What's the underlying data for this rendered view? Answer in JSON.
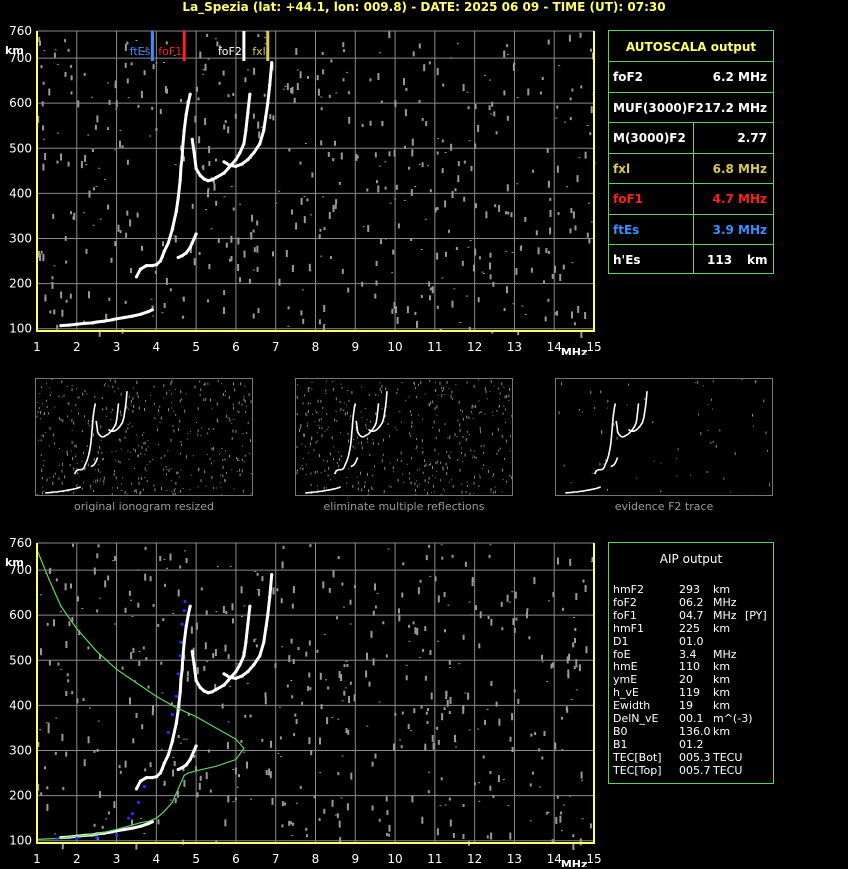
{
  "title": "La_Spezia (lat: +44.1, lon: 009.8) - DATE: 2025 06 09 - TIME (UT): 07:30",
  "colors": {
    "yellow": "#ffff66",
    "green": "#5fd35f",
    "red": "#ff2020",
    "blue": "#3a8fff",
    "olive": "#d9c85a",
    "grid": "#8a8a8a"
  },
  "autoscala": {
    "title": "AUTOSCALA output",
    "rows": [
      {
        "label": "foF2",
        "value": "6.2 MHz",
        "color": "#ffffff"
      },
      {
        "label": "MUF(3000)F2",
        "value": "17.2 MHz",
        "color": "#ffffff"
      },
      {
        "label": "M(3000)F2",
        "value": "2.77",
        "color": "#ffffff"
      },
      {
        "label": "fxl",
        "value": "6.8 MHz",
        "color": "#d9c85a"
      },
      {
        "label": "foF1",
        "value": "4.7 MHz",
        "color": "#ff2020"
      },
      {
        "label": "ftEs",
        "value": "3.9 MHz",
        "color": "#3a8fff"
      },
      {
        "label": "h'Es",
        "value": "113",
        "unit": "km",
        "color": "#ffffff"
      }
    ]
  },
  "aip": {
    "title": "AIP output",
    "rows": [
      {
        "name": "hmF2",
        "value": "293",
        "unit": "km",
        "flag": ""
      },
      {
        "name": "foF2",
        "value": "06.2",
        "unit": "MHz",
        "flag": ""
      },
      {
        "name": "foF1",
        "value": "04.7",
        "unit": "MHz",
        "flag": "[PY]"
      },
      {
        "name": "hmF1",
        "value": "225",
        "unit": "km",
        "flag": ""
      },
      {
        "name": "D1",
        "value": "01.0",
        "unit": "",
        "flag": ""
      },
      {
        "name": "foE",
        "value": "3.4",
        "unit": "MHz",
        "flag": ""
      },
      {
        "name": "hmE",
        "value": "110",
        "unit": "km",
        "flag": ""
      },
      {
        "name": "ymE",
        "value": "20",
        "unit": "km",
        "flag": ""
      },
      {
        "name": "h_vE",
        "value": "119",
        "unit": "km",
        "flag": ""
      },
      {
        "name": "Ewidth",
        "value": "19",
        "unit": "km",
        "flag": ""
      },
      {
        "name": "DelN_vE",
        "value": "00.1",
        "unit": "m^(-3)",
        "flag": ""
      },
      {
        "name": "B0",
        "value": "136.0",
        "unit": "km",
        "flag": ""
      },
      {
        "name": "B1",
        "value": "01.2",
        "unit": "",
        "flag": ""
      },
      {
        "name": "TEC[Bot]",
        "value": "005.3",
        "unit": "TECU",
        "flag": ""
      },
      {
        "name": "TEC[Top]",
        "value": "005.7",
        "unit": "TECU",
        "flag": ""
      }
    ]
  },
  "thumbnails": [
    {
      "label": "original ionogram resized"
    },
    {
      "label": "eliminate multiple reflections"
    },
    {
      "label": "evidence F2 trace"
    }
  ],
  "chart_data": [
    {
      "type": "scatter",
      "title": "",
      "xlabel": "MHz",
      "ylabel": "km",
      "xlim": [
        1,
        15
      ],
      "ylim": [
        95,
        760
      ],
      "xticks": [
        "1",
        "2",
        "3",
        "4",
        "5",
        "6",
        "7",
        "8",
        "9",
        "10",
        "11",
        "12",
        "13",
        "14",
        "15"
      ],
      "yticks": [
        "100",
        "200",
        "300",
        "400",
        "500",
        "600",
        "700",
        "760"
      ],
      "grid": true,
      "markers": [
        {
          "name": "ftEs",
          "x": 3.9,
          "color": "#3a8fff"
        },
        {
          "name": "foF1",
          "x": 4.7,
          "color": "#ff2020"
        },
        {
          "name": "foF2",
          "x": 6.2,
          "color": "#ffffff"
        },
        {
          "name": "fxl",
          "x": 6.8,
          "color": "#d9c85a"
        }
      ],
      "series": [
        {
          "name": "",
          "color": "#ffffff",
          "kind": "trace",
          "x": [
            3.5,
            3.6,
            3.75,
            3.9,
            4.0,
            4.1,
            4.15,
            4.2,
            4.3,
            4.4,
            4.5,
            4.55,
            4.6,
            4.62,
            4.65,
            4.66,
            4.7,
            4.75,
            4.8,
            4.85
          ],
          "y": [
            215,
            232,
            240,
            240,
            242,
            250,
            260,
            272,
            290,
            320,
            360,
            390,
            430,
            460,
            480,
            500,
            540,
            575,
            600,
            620
          ]
        },
        {
          "name": "",
          "color": "#ffffff",
          "kind": "trace",
          "x": [
            4.55,
            4.65,
            4.75,
            4.85,
            4.9,
            4.95,
            5.0
          ],
          "y": [
            258,
            262,
            268,
            280,
            290,
            300,
            310
          ]
        },
        {
          "name": "",
          "color": "#ffffff",
          "kind": "trace",
          "x": [
            4.9,
            4.95,
            5.0,
            5.1,
            5.2,
            5.3,
            5.4,
            5.5,
            5.7,
            5.8,
            5.9,
            6.0,
            6.1,
            6.2,
            6.25,
            6.3,
            6.35
          ],
          "y": [
            520,
            490,
            455,
            440,
            432,
            428,
            430,
            435,
            445,
            455,
            465,
            475,
            490,
            510,
            540,
            580,
            620
          ]
        },
        {
          "name": "",
          "color": "#ffffff",
          "kind": "trace",
          "x": [
            5.7,
            5.85,
            6.0,
            6.15,
            6.3,
            6.45,
            6.6,
            6.7,
            6.75,
            6.8,
            6.85,
            6.9
          ],
          "y": [
            470,
            462,
            460,
            465,
            475,
            490,
            510,
            540,
            570,
            600,
            640,
            690
          ]
        },
        {
          "name": "",
          "color": "#ffffff",
          "kind": "trace",
          "x": [
            1.6,
            1.8,
            2.0,
            2.2,
            2.4,
            2.5,
            2.7,
            2.9,
            3.0,
            3.2,
            3.4,
            3.6,
            3.8,
            3.9
          ],
          "y": [
            107,
            108,
            110,
            112,
            113,
            115,
            117,
            120,
            122,
            125,
            128,
            132,
            138,
            142
          ]
        }
      ]
    },
    {
      "type": "scatter",
      "title": "",
      "xlabel": "MHz",
      "ylabel": "km",
      "xlim": [
        1,
        15
      ],
      "ylim": [
        95,
        760
      ],
      "xticks": [
        "1",
        "2",
        "3",
        "4",
        "5",
        "6",
        "7",
        "8",
        "9",
        "10",
        "11",
        "12",
        "13",
        "14",
        "15"
      ],
      "yticks": [
        "100",
        "200",
        "300",
        "400",
        "500",
        "600",
        "700",
        "760"
      ],
      "grid": true,
      "series": [
        {
          "name": "",
          "color": "#ffffff",
          "kind": "trace",
          "x": [
            3.5,
            3.6,
            3.75,
            3.9,
            4.0,
            4.1,
            4.15,
            4.2,
            4.3,
            4.4,
            4.5,
            4.55,
            4.6,
            4.62,
            4.65,
            4.66,
            4.7,
            4.75,
            4.8,
            4.85
          ],
          "y": [
            215,
            232,
            240,
            240,
            242,
            250,
            260,
            272,
            290,
            320,
            360,
            390,
            430,
            460,
            480,
            500,
            540,
            575,
            600,
            620
          ]
        },
        {
          "name": "",
          "color": "#ffffff",
          "kind": "trace",
          "x": [
            4.55,
            4.65,
            4.75,
            4.85,
            4.9,
            4.95,
            5.0
          ],
          "y": [
            258,
            262,
            268,
            280,
            290,
            300,
            310
          ]
        },
        {
          "name": "",
          "color": "#ffffff",
          "kind": "trace",
          "x": [
            4.9,
            4.95,
            5.0,
            5.1,
            5.2,
            5.3,
            5.4,
            5.5,
            5.7,
            5.8,
            5.9,
            6.0,
            6.1,
            6.2,
            6.25,
            6.3,
            6.35
          ],
          "y": [
            520,
            490,
            455,
            440,
            432,
            428,
            430,
            435,
            445,
            455,
            465,
            475,
            490,
            510,
            540,
            580,
            620
          ]
        },
        {
          "name": "",
          "color": "#ffffff",
          "kind": "trace",
          "x": [
            5.7,
            5.85,
            6.0,
            6.15,
            6.3,
            6.45,
            6.6,
            6.7,
            6.75,
            6.8,
            6.85,
            6.9
          ],
          "y": [
            470,
            462,
            460,
            465,
            475,
            490,
            510,
            540,
            570,
            600,
            640,
            690
          ]
        },
        {
          "name": "",
          "color": "#ffffff",
          "kind": "trace",
          "x": [
            1.6,
            1.8,
            2.0,
            2.2,
            2.4,
            2.5,
            2.7,
            2.9,
            3.0,
            3.2,
            3.4,
            3.6,
            3.8,
            3.9
          ],
          "y": [
            107,
            108,
            110,
            112,
            113,
            115,
            117,
            120,
            122,
            125,
            128,
            132,
            138,
            142
          ]
        },
        {
          "name": "",
          "color": "#5fd35f",
          "kind": "profile",
          "x": [
            1.0,
            1.3,
            1.6,
            2.0,
            2.5,
            3.0,
            3.5,
            4.0,
            4.5,
            5.0,
            5.5,
            6.0,
            6.2,
            6.0,
            5.5,
            5.0,
            4.8,
            4.7,
            4.6,
            4.5,
            4.4,
            4.2,
            4.0,
            3.8,
            3.6,
            3.4,
            3.2,
            3.0,
            2.5,
            2.0,
            1.5,
            1.0
          ],
          "y": [
            745,
            680,
            620,
            570,
            520,
            480,
            450,
            420,
            395,
            375,
            350,
            325,
            305,
            280,
            265,
            255,
            250,
            245,
            225,
            205,
            185,
            165,
            150,
            143,
            140,
            135,
            130,
            125,
            115,
            110,
            105,
            103
          ]
        },
        {
          "name": "",
          "color": "#2030ff",
          "kind": "dots",
          "x": [
            4.3,
            4.4,
            4.5,
            4.55,
            4.6,
            4.62,
            4.65,
            4.7,
            4.72,
            3.3,
            3.4,
            3.55,
            3.7,
            1.5,
            2.0,
            2.5,
            3.0
          ],
          "y": [
            340,
            380,
            420,
            470,
            510,
            540,
            580,
            610,
            630,
            150,
            160,
            185,
            220,
            104,
            105,
            107,
            112
          ]
        }
      ]
    }
  ]
}
